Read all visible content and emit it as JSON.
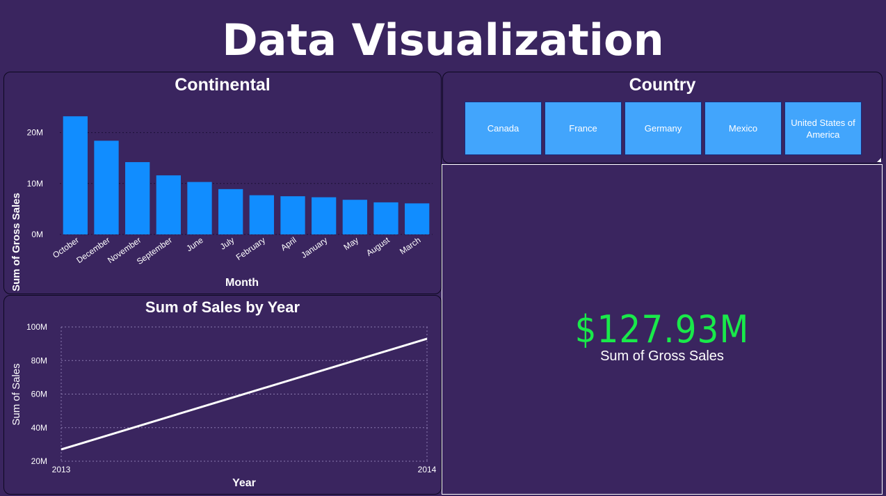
{
  "page": {
    "title": "Data Visualization"
  },
  "continental": {
    "title": "Continental",
    "xlabel": "Month",
    "ylabel": "Sum of Gross Sales",
    "yticks": [
      "0M",
      "10M",
      "20M"
    ]
  },
  "country": {
    "title": "Country",
    "options": [
      "Canada",
      "France",
      "Germany",
      "Mexico",
      "United States of America"
    ]
  },
  "yearly": {
    "title": "Sum of Sales by Year",
    "xlabel": "Year",
    "ylabel": "Sum of Sales",
    "yticks": [
      "20M",
      "40M",
      "60M",
      "80M",
      "100M"
    ],
    "xticks": [
      "2013",
      "2014"
    ]
  },
  "kpi": {
    "value": "$127.93M",
    "label": "Sum of Gross Sales",
    "color": "#19e94a"
  },
  "colors": {
    "background": "#3a255f",
    "bar": "#118dff",
    "slicer": "#42a5fc",
    "line": "#ffffff"
  },
  "chart_data": [
    {
      "type": "bar",
      "title": "Continental",
      "xlabel": "Month",
      "ylabel": "Sum of Gross Sales",
      "categories": [
        "October",
        "December",
        "November",
        "September",
        "June",
        "July",
        "February",
        "April",
        "January",
        "May",
        "August",
        "March"
      ],
      "values": [
        23.2,
        18.4,
        14.2,
        11.6,
        10.3,
        8.9,
        7.7,
        7.5,
        7.3,
        6.8,
        6.3,
        6.1
      ],
      "value_unit": "M",
      "ylim": [
        0,
        25
      ],
      "grid": true
    },
    {
      "type": "line",
      "title": "Sum of Sales by Year",
      "xlabel": "Year",
      "ylabel": "Sum of Sales",
      "x": [
        "2013",
        "2014"
      ],
      "values": [
        27,
        93
      ],
      "value_unit": "M",
      "ylim": [
        20,
        100
      ],
      "grid": true
    }
  ]
}
